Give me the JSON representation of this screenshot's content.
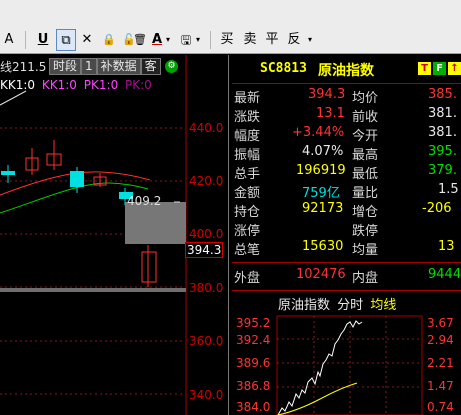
{
  "toolbar": {
    "btn_a": "A",
    "btn_underline": "U",
    "btn_copy": "⧉",
    "btn_close": "✕",
    "btn_lock": "🔒",
    "btn_unlock": "🔓",
    "btn_delete": "🗑",
    "btn_color": "A",
    "btn_save": "🖫",
    "btn_buy": "买",
    "btn_sell": "卖",
    "btn_flat": "平",
    "btn_reverse": "反"
  },
  "chart": {
    "info_prefix": "线211.5",
    "tab_timeshare": "时段",
    "tab_page": "1",
    "tab_supplement": "补数据",
    "tab_other": "客",
    "ind_kk": "KK1:0",
    "ind_kk2": "KK1:0",
    "ind_pk": "PK1:0",
    "ind_pk2": "PK:0",
    "price_labels": [
      "440.0",
      "420.0",
      "400.0",
      "380.0",
      "360.0",
      "340.0"
    ],
    "current_price": "394.3",
    "level_label": "409.2"
  },
  "quote": {
    "code": "SC8813",
    "name": "原油指数",
    "flag_t": "T",
    "flag_f": "F",
    "rows": [
      {
        "l1": "最新",
        "v1": "394.3",
        "l2": "均价",
        "v2": "385."
      },
      {
        "l1": "涨跌",
        "v1": "13.1",
        "l2": "前收",
        "v2": "381."
      },
      {
        "l1": "幅度",
        "v1": "+3.44%",
        "l2": "今开",
        "v2": "381."
      },
      {
        "l1": "振幅",
        "v1": "4.07%",
        "l2": "最高",
        "v2": "395."
      },
      {
        "l1": "总手",
        "v1": "196919",
        "l2": "最低",
        "v2": "379."
      },
      {
        "l1": "金额",
        "v1": "759亿",
        "l2": "量比",
        "v2": "1.5"
      },
      {
        "l1": "持仓",
        "v1": "92173",
        "l2": "增仓",
        "v2": "-206"
      },
      {
        "l1": "涨停",
        "v1": "",
        "l2": "跌停",
        "v2": ""
      },
      {
        "l1": "总笔",
        "v1": "15630",
        "l2": "均量",
        "v2": "13"
      }
    ],
    "outer_label": "外盘",
    "outer_value": "102476",
    "inner_label": "内盘",
    "inner_value": "9444"
  },
  "mini": {
    "title_name": "原油指数",
    "title_period": "分时",
    "title_avg": "均线",
    "left_labels": [
      "395.2",
      "392.4",
      "389.6",
      "386.8",
      "384.0"
    ],
    "right_labels": [
      "3.67",
      "2.94",
      "2.21",
      "1.47",
      "0.74"
    ]
  },
  "colors": {
    "up": "#ff3333",
    "yellow": "#ffff00",
    "green": "#00e000",
    "cyan": "#00e0e0"
  }
}
